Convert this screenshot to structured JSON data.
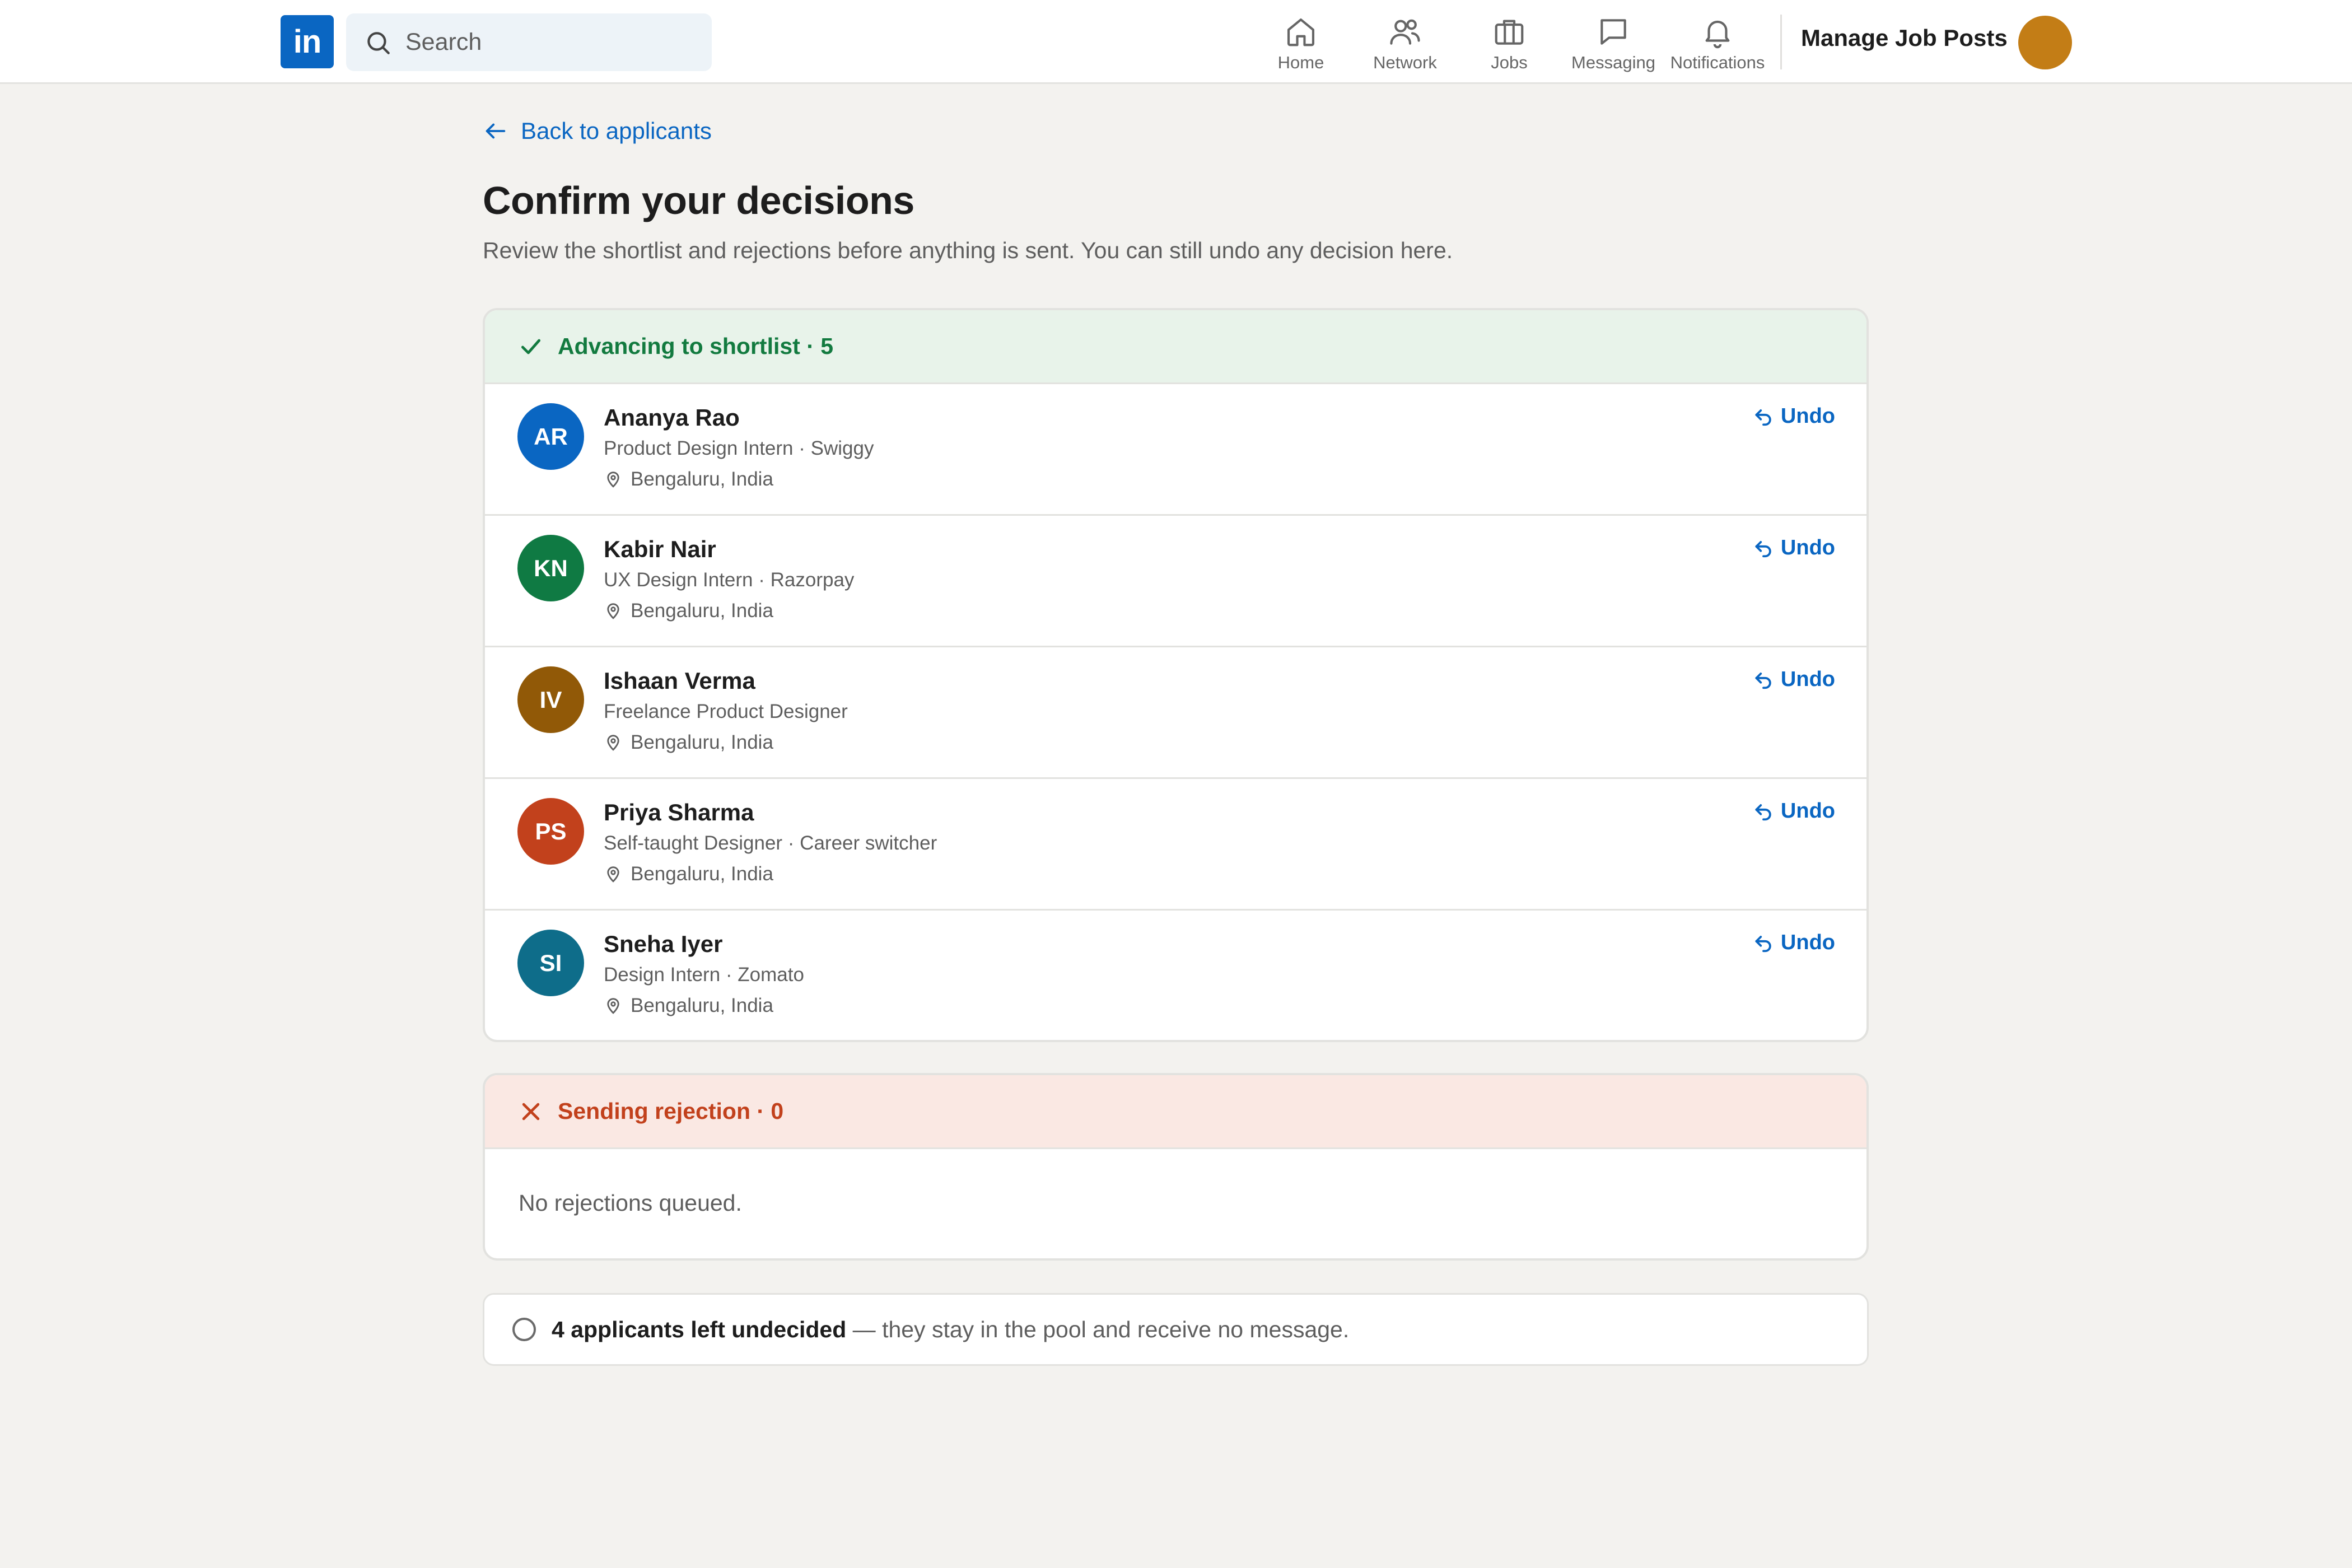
{
  "nav": {
    "logo_text": "in",
    "search_placeholder": "Search",
    "items": [
      {
        "label": "Home",
        "icon": "home-icon"
      },
      {
        "label": "Network",
        "icon": "network-icon"
      },
      {
        "label": "Jobs",
        "icon": "jobs-icon"
      },
      {
        "label": "Messaging",
        "icon": "messaging-icon"
      },
      {
        "label": "Notifications",
        "icon": "notifications-icon"
      }
    ],
    "manage_label": "Manage Job Posts"
  },
  "page": {
    "back_label": "Back to applicants",
    "title": "Confirm your decisions",
    "subtitle": "Review the shortlist and rejections before anything is sent. You can still undo any decision here."
  },
  "shortlist": {
    "header": "Advancing to shortlist · 5",
    "undo_label": "Undo",
    "candidates": [
      {
        "initials": "AR",
        "name": "Ananya Rao",
        "role": "Product Design Intern · Swiggy",
        "location": "Bengaluru, India",
        "color": "#0a66c2"
      },
      {
        "initials": "KN",
        "name": "Kabir Nair",
        "role": "UX Design Intern · Razorpay",
        "location": "Bengaluru, India",
        "color": "#0f7a43"
      },
      {
        "initials": "IV",
        "name": "Ishaan Verma",
        "role": "Freelance Product Designer",
        "location": "Bengaluru, India",
        "color": "#915907"
      },
      {
        "initials": "PS",
        "name": "Priya Sharma",
        "role": "Self-taught Designer · Career switcher",
        "location": "Bengaluru, India",
        "color": "#c2411c"
      },
      {
        "initials": "SI",
        "name": "Sneha Iyer",
        "role": "Design Intern · Zomato",
        "location": "Bengaluru, India",
        "color": "#0e6d8a"
      }
    ]
  },
  "rejection": {
    "header": "Sending rejection · 0",
    "empty_message": "No rejections queued."
  },
  "undecided": {
    "strong_text": "4 applicants left undecided",
    "rest_text": " — they stay in the pool and receive no message."
  },
  "colors": {
    "brand": "#0a66c2",
    "shortlist_accent": "#127a3f",
    "reject_accent": "#c2411c",
    "user_avatar": "#c37d16"
  }
}
